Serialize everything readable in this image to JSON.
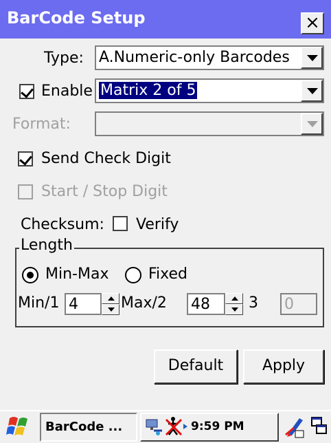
{
  "window": {
    "title": "BarCode Setup",
    "close_label": "×"
  },
  "type": {
    "label": "Type:",
    "value": "A.Numeric-only Barcodes"
  },
  "enable": {
    "label": "Enable",
    "checked": true,
    "value": "Matrix 2 of 5"
  },
  "format": {
    "label": "Format:",
    "value": ""
  },
  "send_check_digit": {
    "label": "Send Check Digit",
    "checked": true
  },
  "start_stop_digit": {
    "label": "Start / Stop Digit",
    "checked": false,
    "disabled": true
  },
  "checksum": {
    "label": "Checksum:",
    "verify_label": "Verify",
    "verify_checked": false
  },
  "length": {
    "legend": "Length",
    "minmax_label": "Min-Max",
    "fixed_label": "Fixed",
    "selected": "Min-Max",
    "min_label": "Min/1",
    "min_value": "4",
    "max_label": "Max/2",
    "max_value": "48",
    "third_label": "3",
    "third_value": "0"
  },
  "buttons": {
    "default_label": "Default",
    "apply_label": "Apply"
  },
  "taskbar": {
    "task_label": "BarCode ...",
    "time": "9:59 PM",
    "icons": [
      "start-flag-icon",
      "network-icon",
      "sync-icon",
      "input-panel-icon",
      "desktop-switch-icon"
    ]
  },
  "colors": {
    "title_bar": "#6c6cf0",
    "selection": "#000080"
  }
}
